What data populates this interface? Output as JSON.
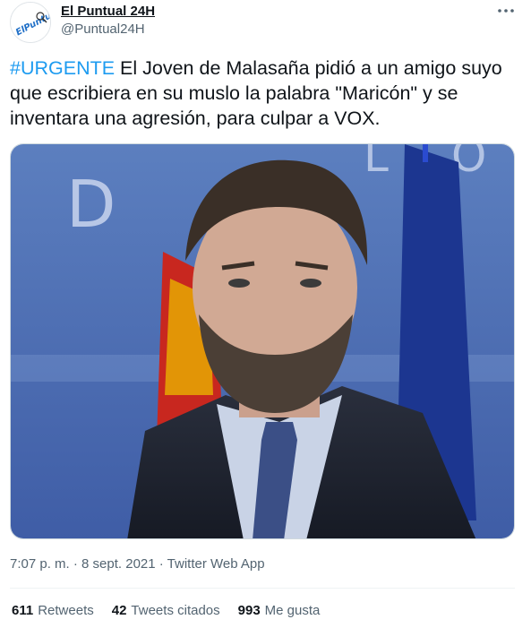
{
  "author": {
    "display_name": "El Puntual 24H",
    "handle": "@Puntual24H",
    "avatar_logo_text": "ElPuntual"
  },
  "tweet": {
    "hashtag": "#URGENTE",
    "body": " El Joven de Malasaña pidió a un amigo suyo que escribiera en su muslo la palabra \"Maricón\" y se inventara una agresión, para culpar a VOX."
  },
  "timestamp": "7:07 p. m. · 8 sept. 2021 · Twitter Web App",
  "stats": {
    "retweets_count": "611",
    "retweets_label": "Retweets",
    "quotes_count": "42",
    "quotes_label": "Tweets citados",
    "likes_count": "993",
    "likes_label": "Me gusta"
  },
  "icons": {
    "more": "more-options-icon"
  },
  "colors": {
    "accent": "#1d9bf0",
    "secondary_text": "#536471",
    "primary_text": "#0f1419"
  }
}
